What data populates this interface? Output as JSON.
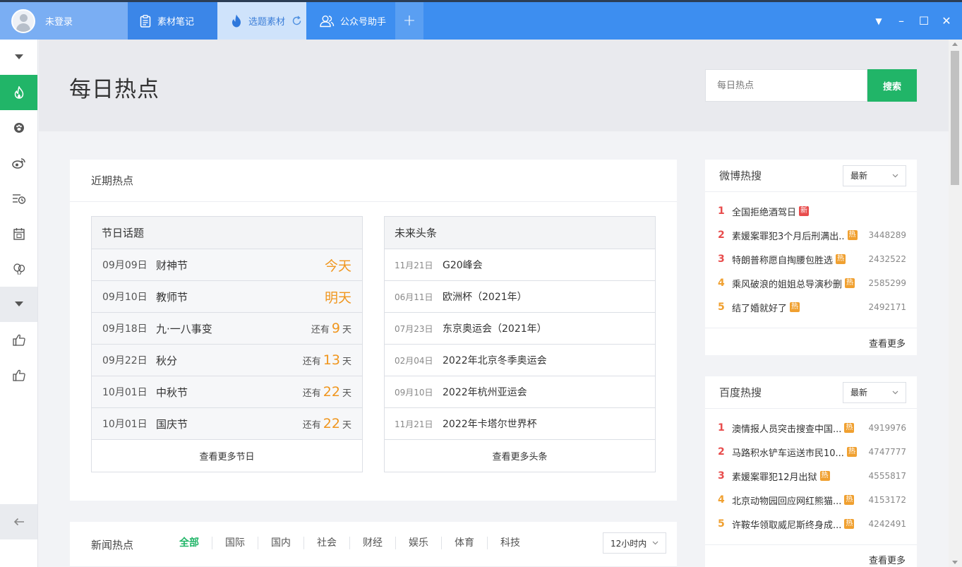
{
  "topbar": {
    "user_label": "未登录",
    "tabs": [
      {
        "label": "素材笔记"
      },
      {
        "label": "选题素材"
      },
      {
        "label": "公众号助手"
      }
    ],
    "add_tab": "+",
    "win": {
      "menu": "▼",
      "minimize": "–",
      "maximize": "☐",
      "close": "✕"
    }
  },
  "page": {
    "title": "每日热点",
    "search_placeholder": "每日热点",
    "search_button": "搜索"
  },
  "recent": {
    "title": "近期热点",
    "festival": {
      "title": "节日话题",
      "rows": [
        {
          "date": "09月09日",
          "name": "财神节",
          "label": "今天"
        },
        {
          "date": "09月10日",
          "name": "教师节",
          "label": "明天"
        },
        {
          "date": "09月18日",
          "name": "九·一八事变",
          "prefix": "还有",
          "num": "9",
          "suffix": "天"
        },
        {
          "date": "09月22日",
          "name": "秋分",
          "prefix": "还有",
          "num": "13",
          "suffix": "天"
        },
        {
          "date": "10月01日",
          "name": "中秋节",
          "prefix": "还有",
          "num": "22",
          "suffix": "天"
        },
        {
          "date": "10月01日",
          "name": "国庆节",
          "prefix": "还有",
          "num": "22",
          "suffix": "天"
        }
      ],
      "more": "查看更多节日"
    },
    "future": {
      "title": "未来头条",
      "rows": [
        {
          "date": "11月21日",
          "name": "G20峰会"
        },
        {
          "date": "06月11日",
          "name": "欧洲杯（2021年）"
        },
        {
          "date": "07月23日",
          "name": "东京奥运会（2021年）"
        },
        {
          "date": "02月04日",
          "name": "2022年北京冬季奥运会"
        },
        {
          "date": "09月10日",
          "name": "2022年杭州亚运会"
        },
        {
          "date": "11月21日",
          "name": "2022年卡塔尔世界杯"
        }
      ],
      "more": "查看更多头条"
    }
  },
  "weibo": {
    "title": "微博热搜",
    "select": "最新",
    "items": [
      {
        "rank": "1",
        "title": "全国拒绝酒驾日",
        "tag": "新",
        "count": ""
      },
      {
        "rank": "2",
        "title": "素媛案罪犯3个月后刑满出..",
        "tag": "热",
        "count": "3448289"
      },
      {
        "rank": "3",
        "title": "特朗普称愿自掏腰包胜选",
        "tag": "热",
        "count": "2432522"
      },
      {
        "rank": "4",
        "title": "乘风破浪的姐姐总导演秒删",
        "tag": "热",
        "count": "2585299"
      },
      {
        "rank": "5",
        "title": "结了婚就好了",
        "tag": "热",
        "count": "2492171"
      }
    ],
    "more": "查看更多"
  },
  "baidu": {
    "title": "百度热搜",
    "select": "最新",
    "items": [
      {
        "rank": "1",
        "title": "澳情报人员突击搜查中国...",
        "tag": "热",
        "count": "4919976"
      },
      {
        "rank": "2",
        "title": "马路积水铲车运送市民10...",
        "tag": "热",
        "count": "4747777"
      },
      {
        "rank": "3",
        "title": "素媛案罪犯12月出狱",
        "tag": "热",
        "count": "4555817"
      },
      {
        "rank": "4",
        "title": "北京动物园回应网红熊猫...",
        "tag": "热",
        "count": "4153172"
      },
      {
        "rank": "5",
        "title": "许鞍华领取威尼斯终身成...",
        "tag": "热",
        "count": "4242491"
      }
    ],
    "more": "查看更多"
  },
  "news": {
    "title": "新闻热点",
    "tabs": [
      "全部",
      "国际",
      "国内",
      "社会",
      "财经",
      "娱乐",
      "体育",
      "科技"
    ],
    "select": "12小时内"
  },
  "colors": {
    "accent": "#21b568",
    "topbar": "#3d8ef0",
    "orange": "#f0961e",
    "rank_top": "#e84c4c",
    "rank_rest": "#f0a030"
  }
}
